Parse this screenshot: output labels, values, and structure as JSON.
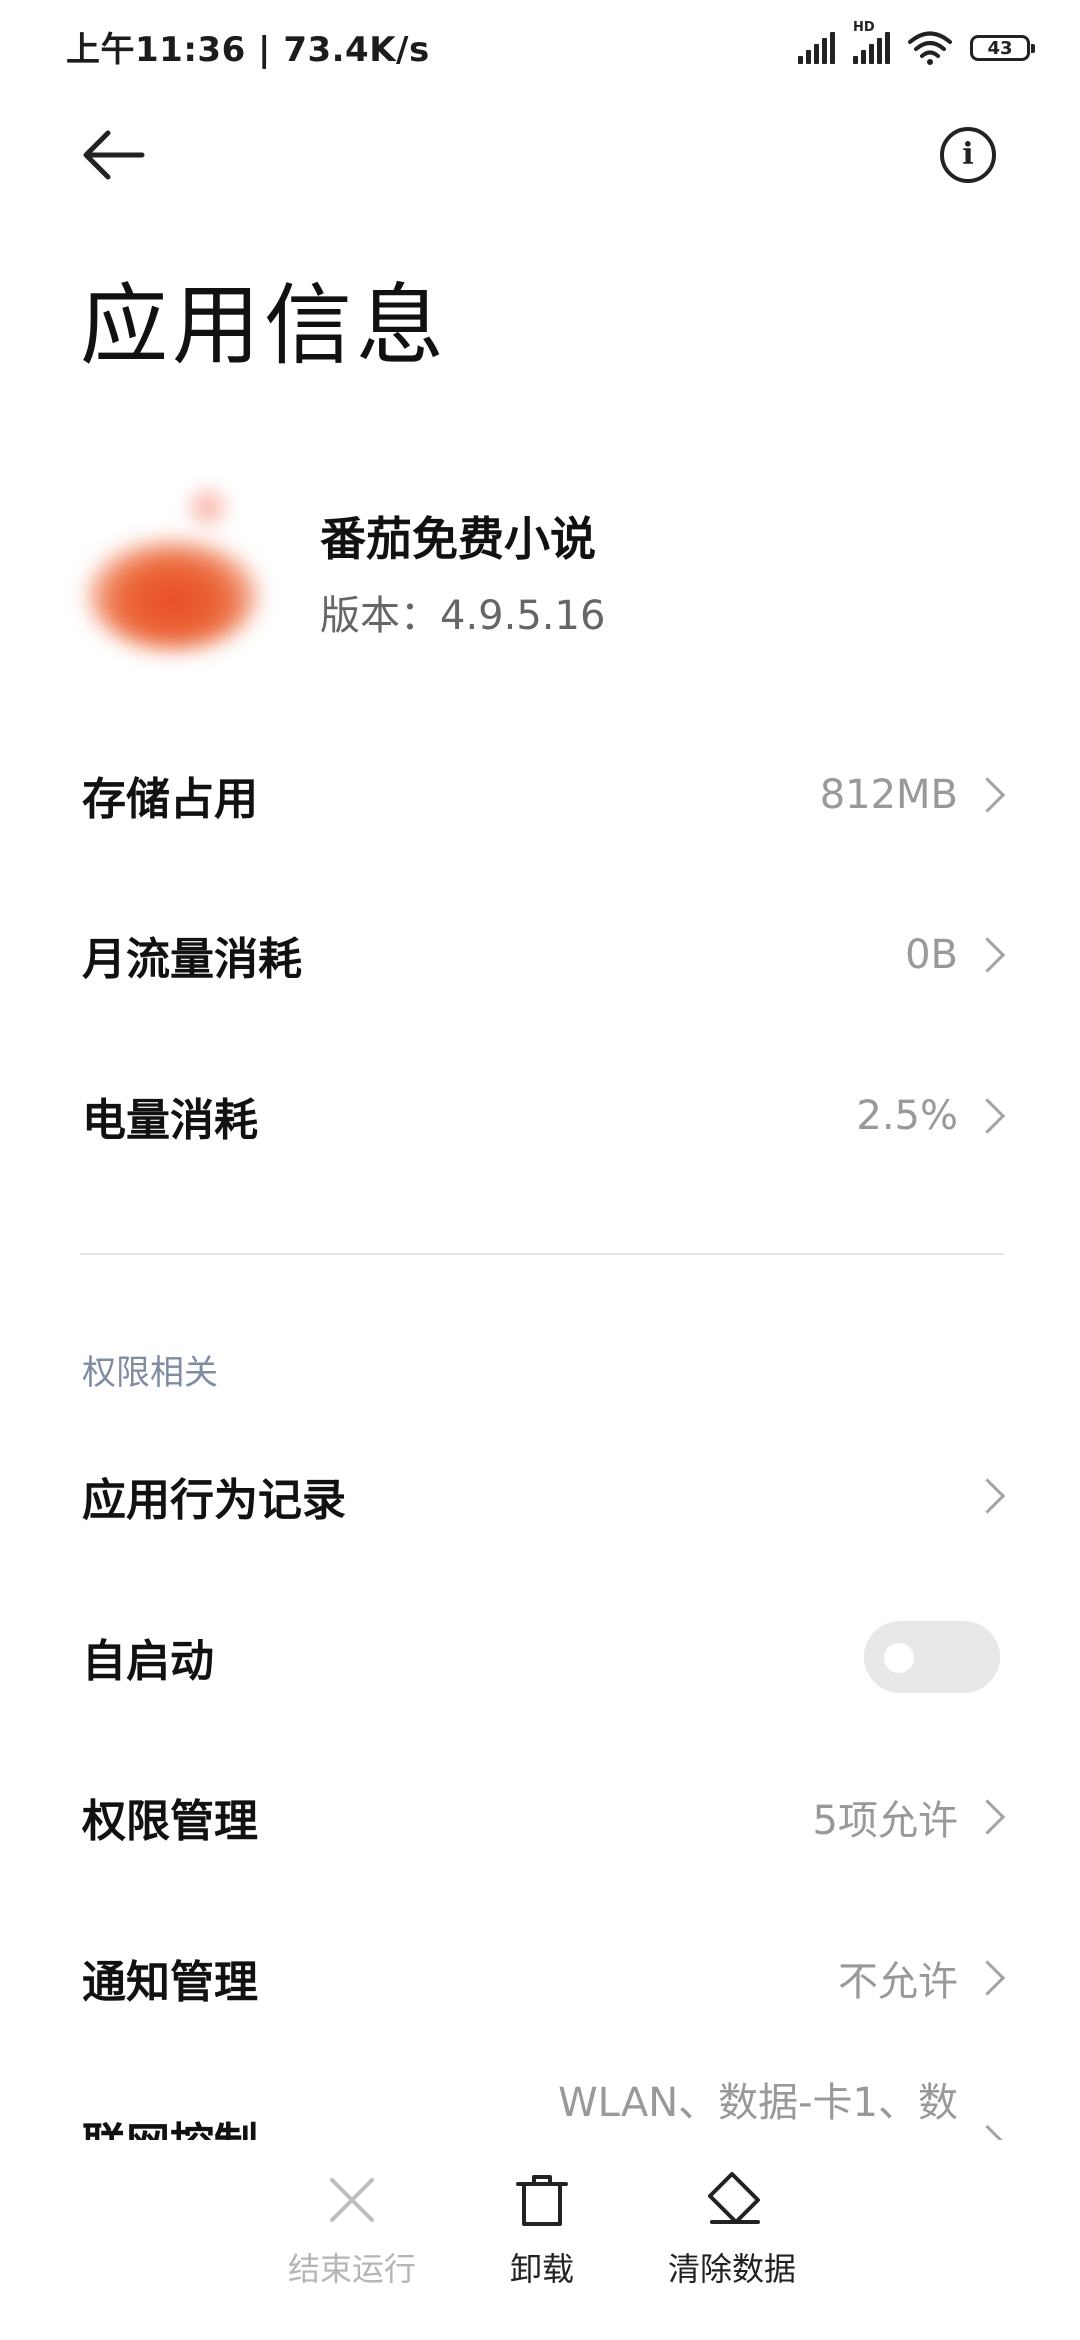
{
  "status_bar": {
    "time_speed": "上午11:36 | 73.4K/s",
    "hd_label": "HD",
    "battery": "43"
  },
  "header": {
    "title": "应用信息"
  },
  "app": {
    "name": "番茄免费小说",
    "version": "版本：4.9.5.16"
  },
  "rows": {
    "storage": {
      "label": "存储占用",
      "value": "812MB"
    },
    "data": {
      "label": "月流量消耗",
      "value": "0B"
    },
    "battery": {
      "label": "电量消耗",
      "value": "2.5%"
    }
  },
  "permissions_section": {
    "title": "权限相关",
    "behavior": {
      "label": "应用行为记录"
    },
    "autostart": {
      "label": "自启动",
      "enabled": false
    },
    "permissions": {
      "label": "权限管理",
      "value": "5项允许"
    },
    "notifications": {
      "label": "通知管理",
      "value": "不允许"
    },
    "network": {
      "label": "联网控制",
      "value": "WLAN、数据-卡1、数"
    }
  },
  "bottom_actions": {
    "force_stop": {
      "label": "结束运行",
      "icon": "close-icon",
      "enabled": false
    },
    "uninstall": {
      "label": "卸载",
      "icon": "trash-icon",
      "enabled": true
    },
    "clear_data": {
      "label": "清除数据",
      "icon": "eraser-icon",
      "enabled": true
    }
  },
  "colors": {
    "section_title": "#7f8ca2",
    "value_text": "#999999",
    "disabled_text": "#b5b5b5",
    "app_icon": "#e84a24"
  }
}
